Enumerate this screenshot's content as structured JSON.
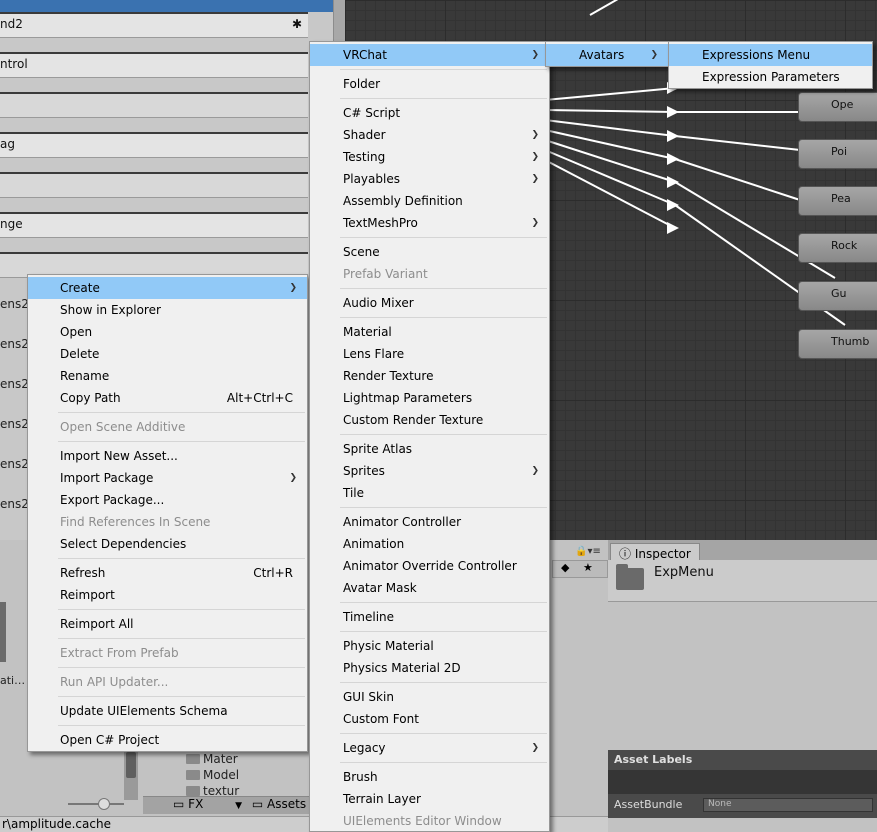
{
  "left_panel": {
    "rows": [
      "nd2",
      "ntrol",
      "",
      "ag",
      "",
      "nge",
      "",
      "ens2",
      "ens2",
      "ens2",
      "ens2",
      "ens2",
      "ens2"
    ],
    "gear_icon": "gear-icon"
  },
  "graph": {
    "states": [
      "Ope",
      "Poi",
      "Pea",
      "Rock",
      "Gu",
      "Thumb"
    ]
  },
  "project": {
    "asset_caption": "ati…",
    "tree_items": [
      "Mater",
      "Model",
      "textur"
    ],
    "breadcrumb_folder": "FX",
    "breadcrumb_assets": "Assets",
    "status_path": "r\\amplitude.cache"
  },
  "inspector": {
    "tab_label": "Inspector",
    "asset_name": "ExpMenu",
    "asset_labels_title": "Asset Labels",
    "asset_bundle_label": "AssetBundle",
    "asset_bundle_value": "None"
  },
  "context_menu": {
    "items": [
      {
        "label": "Create",
        "submenu": true,
        "highlighted": true
      },
      {
        "label": "Show in Explorer"
      },
      {
        "label": "Open"
      },
      {
        "label": "Delete"
      },
      {
        "label": "Rename"
      },
      {
        "label": "Copy Path",
        "shortcut": "Alt+Ctrl+C"
      },
      {
        "separator": true
      },
      {
        "label": "Open Scene Additive",
        "disabled": true
      },
      {
        "separator": true
      },
      {
        "label": "Import New Asset..."
      },
      {
        "label": "Import Package",
        "submenu": true
      },
      {
        "label": "Export Package..."
      },
      {
        "label": "Find References In Scene",
        "disabled": true
      },
      {
        "label": "Select Dependencies"
      },
      {
        "separator": true
      },
      {
        "label": "Refresh",
        "shortcut": "Ctrl+R"
      },
      {
        "label": "Reimport"
      },
      {
        "separator": true
      },
      {
        "label": "Reimport All"
      },
      {
        "separator": true
      },
      {
        "label": "Extract From Prefab",
        "disabled": true
      },
      {
        "separator": true
      },
      {
        "label": "Run API Updater...",
        "disabled": true
      },
      {
        "separator": true
      },
      {
        "label": "Update UIElements Schema"
      },
      {
        "separator": true
      },
      {
        "label": "Open C# Project"
      }
    ]
  },
  "create_menu": {
    "items": [
      {
        "label": "VRChat",
        "submenu": true,
        "highlighted": true
      },
      {
        "separator": true
      },
      {
        "label": "Folder"
      },
      {
        "separator": true
      },
      {
        "label": "C# Script"
      },
      {
        "label": "Shader",
        "submenu": true
      },
      {
        "label": "Testing",
        "submenu": true
      },
      {
        "label": "Playables",
        "submenu": true
      },
      {
        "label": "Assembly Definition"
      },
      {
        "label": "TextMeshPro",
        "submenu": true
      },
      {
        "separator": true
      },
      {
        "label": "Scene"
      },
      {
        "label": "Prefab Variant",
        "disabled": true
      },
      {
        "separator": true
      },
      {
        "label": "Audio Mixer"
      },
      {
        "separator": true
      },
      {
        "label": "Material"
      },
      {
        "label": "Lens Flare"
      },
      {
        "label": "Render Texture"
      },
      {
        "label": "Lightmap Parameters"
      },
      {
        "label": "Custom Render Texture"
      },
      {
        "separator": true
      },
      {
        "label": "Sprite Atlas"
      },
      {
        "label": "Sprites",
        "submenu": true
      },
      {
        "label": "Tile"
      },
      {
        "separator": true
      },
      {
        "label": "Animator Controller"
      },
      {
        "label": "Animation"
      },
      {
        "label": "Animator Override Controller"
      },
      {
        "label": "Avatar Mask"
      },
      {
        "separator": true
      },
      {
        "label": "Timeline"
      },
      {
        "separator": true
      },
      {
        "label": "Physic Material"
      },
      {
        "label": "Physics Material 2D"
      },
      {
        "separator": true
      },
      {
        "label": "GUI Skin"
      },
      {
        "label": "Custom Font"
      },
      {
        "separator": true
      },
      {
        "label": "Legacy",
        "submenu": true
      },
      {
        "separator": true
      },
      {
        "label": "Brush"
      },
      {
        "label": "Terrain Layer"
      },
      {
        "label": "UIElements Editor Window",
        "disabled": true
      }
    ]
  },
  "vrchat_menu": {
    "items": [
      {
        "label": "Avatars",
        "submenu": true,
        "highlighted": true
      }
    ]
  },
  "avatars_menu": {
    "items": [
      {
        "label": "Expressions Menu",
        "highlighted": true
      },
      {
        "label": "Expression Parameters"
      }
    ]
  }
}
